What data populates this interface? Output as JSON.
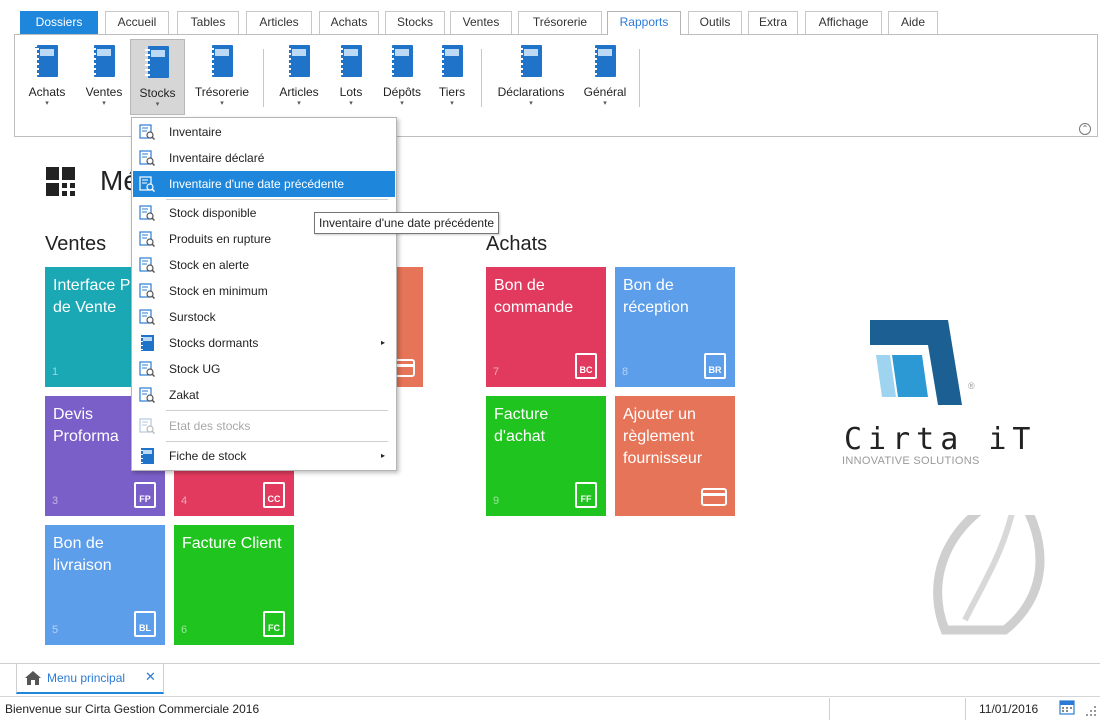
{
  "tabs": [
    "Dossiers",
    "Accueil",
    "Tables",
    "Articles",
    "Achats",
    "Stocks",
    "Ventes",
    "Trésorerie",
    "Rapports",
    "Outils",
    "Extra",
    "Affichage",
    "Aide"
  ],
  "active_tab": "Rapports",
  "ribbon": {
    "buttons": [
      "Achats",
      "Ventes",
      "Stocks",
      "Trésorerie",
      "Articles",
      "Lots",
      "Dépôts",
      "Tiers",
      "Déclarations",
      "Général"
    ],
    "pressed": "Stocks",
    "caret": "▾",
    "collapse_glyph": "⌃"
  },
  "main": {
    "title": "Menu principal",
    "title_visible": "Mé",
    "ventes_title": "Ventes",
    "achats_title": "Achats"
  },
  "tiles": {
    "t1": {
      "label": "Interface Point de Vente",
      "num": "1"
    },
    "t3": {
      "label": "Devis Proforma",
      "num": "3",
      "badge": "FP"
    },
    "t4": {
      "num": "4",
      "badge": "CC"
    },
    "t5": {
      "label": "Bon de livraison",
      "num": "5",
      "badge": "BL"
    },
    "t6": {
      "label": "Facture Client",
      "num": "6",
      "badge": "FC"
    },
    "t7": {
      "label": "Bon de commande",
      "num": "7",
      "badge": "BC"
    },
    "t8": {
      "label": "Bon de réception",
      "num": "8",
      "badge": "BR"
    },
    "t9": {
      "label": "Facture d'achat",
      "num": "9",
      "badge": "FF"
    },
    "t10": {
      "label": "Ajouter un règlement fournisseur"
    }
  },
  "colors": {
    "teal": "#1aa8b5",
    "purple": "#7a5fc9",
    "crimson": "#e23a5e",
    "blue": "#5c9eea",
    "green": "#1fc41f",
    "salmon": "#e67459",
    "accent": "#1e87dc"
  },
  "logo": {
    "name": "Cirta iT",
    "tagline": "INNOVATIVE SOLUTIONS",
    "reg": "®"
  },
  "dropdown": {
    "items": [
      {
        "label": "Inventaire"
      },
      {
        "label": "Inventaire déclaré"
      },
      {
        "label": "Inventaire d'une date précédente"
      },
      {
        "label": "Stock disponible"
      },
      {
        "label": "Produits en rupture"
      },
      {
        "label": "Stock en alerte"
      },
      {
        "label": "Stock en minimum"
      },
      {
        "label": "Surstock"
      },
      {
        "label": "Stocks dormants"
      },
      {
        "label": "Stock UG"
      },
      {
        "label": "Zakat"
      },
      {
        "label": "Etat des stocks"
      },
      {
        "label": "Fiche de stock"
      }
    ],
    "highlighted": "Inventaire d'une date précédente",
    "submenu_arrow": "▸"
  },
  "tooltip": "Inventaire d'une date précédente",
  "doc_tab": {
    "label": "Menu principal",
    "close": "✕"
  },
  "status": {
    "message": "Bienvenue sur Cirta Gestion Commerciale 2016",
    "date": "11/01/2016"
  }
}
